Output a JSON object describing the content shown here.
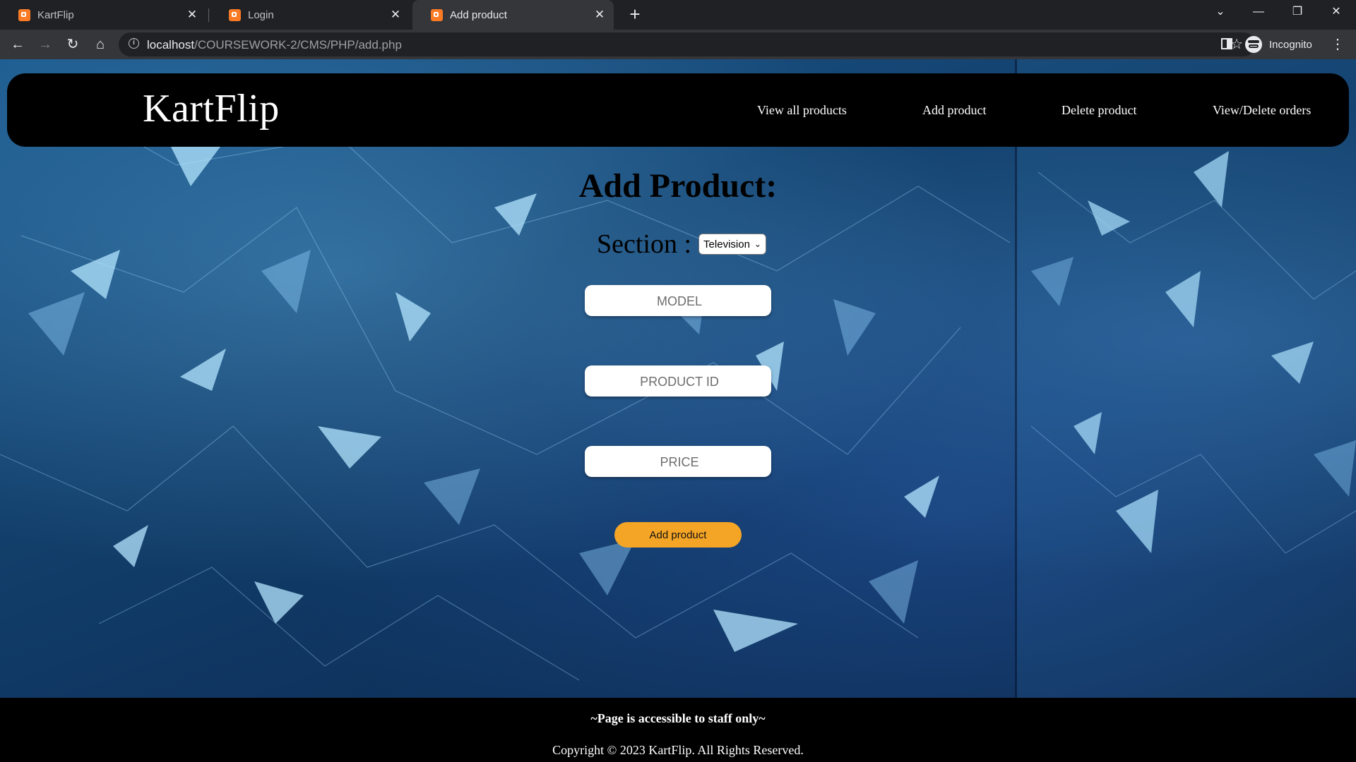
{
  "browser": {
    "tabs": [
      {
        "title": "KartFlip",
        "active": false
      },
      {
        "title": "Login",
        "active": false
      },
      {
        "title": "Add product",
        "active": true
      }
    ],
    "url_host": "localhost",
    "url_path": "/COURSEWORK-2/CMS/PHP/add.php",
    "profile_label": "Incognito"
  },
  "site": {
    "brand": "KartFlip",
    "nav": [
      "View all products",
      "Add product",
      "Delete product",
      "View/Delete orders"
    ]
  },
  "form": {
    "title": "Add Product:",
    "section_label": "Section :",
    "section_value": "Television",
    "model_placeholder": "MODEL",
    "product_id_placeholder": "PRODUCT ID",
    "price_placeholder": "PRICE",
    "submit_label": "Add product"
  },
  "footer": {
    "note": "~Page is accessible to staff only~",
    "copyright": "Copyright © 2023 KartFlip. All Rights Reserved."
  },
  "colors": {
    "accent_button": "#f5a526",
    "favicon": "#fb7a24",
    "header_bg": "#000000"
  }
}
